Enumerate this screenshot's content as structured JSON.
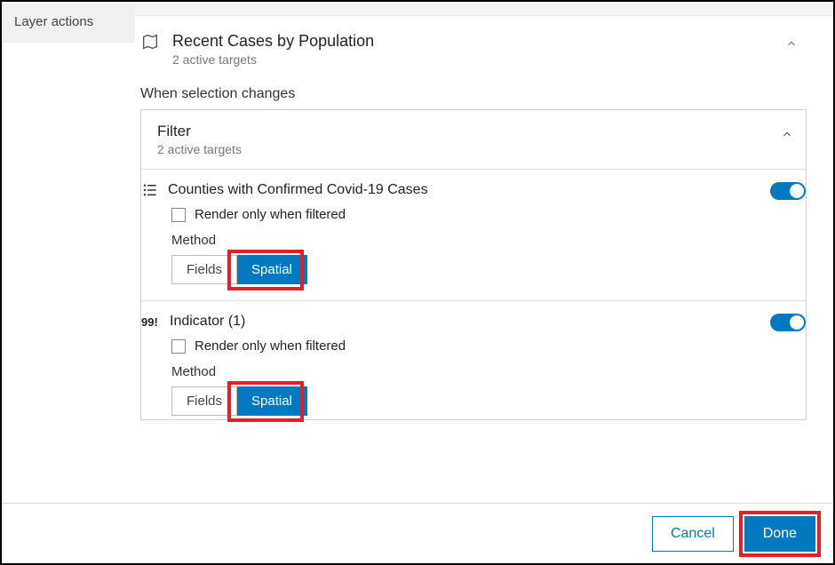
{
  "sidebar": {
    "tab": "Layer actions"
  },
  "layer": {
    "title": "Recent Cases by Population",
    "subtitle": "2 active targets",
    "section_label": "When selection changes"
  },
  "filter": {
    "title": "Filter",
    "subtitle": "2 active targets"
  },
  "targets": [
    {
      "name": "Counties with Confirmed Covid-19 Cases",
      "render_label": "Render only when filtered",
      "method_label": "Method",
      "fields_label": "Fields",
      "spatial_label": "Spatial"
    },
    {
      "name": "Indicator (1)",
      "render_label": "Render only when filtered",
      "method_label": "Method",
      "fields_label": "Fields",
      "spatial_label": "Spatial"
    }
  ],
  "footer": {
    "cancel": "Cancel",
    "done": "Done"
  },
  "colors": {
    "accent": "#0079c1",
    "highlight": "#e0202a"
  }
}
